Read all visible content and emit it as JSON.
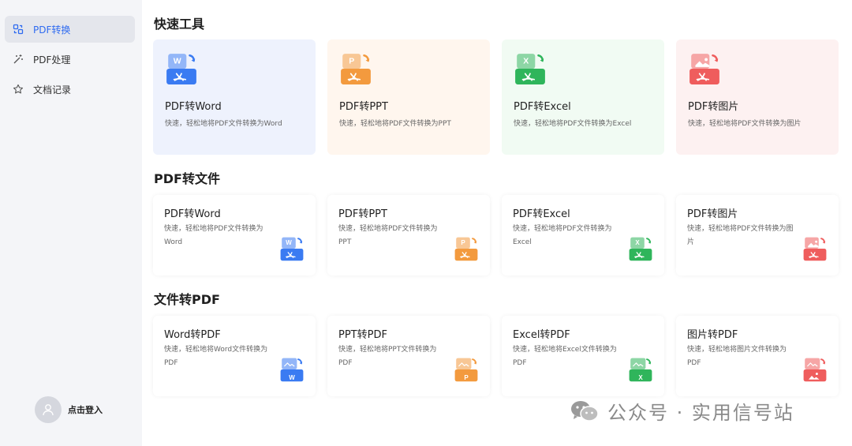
{
  "sidebar": {
    "items": [
      {
        "label": "PDF转换",
        "icon": "grid-swap-icon",
        "active": true
      },
      {
        "label": "PDF处理",
        "icon": "magic-wand-icon",
        "active": false
      },
      {
        "label": "文档记录",
        "icon": "star-icon",
        "active": false
      }
    ],
    "login_label": "点击登入"
  },
  "sections": {
    "quick": {
      "title": "快速工具",
      "cards": [
        {
          "title": "PDF转Word",
          "desc": "快速，轻松地将PDF文件转换为Word",
          "color": "#3a7bf2",
          "letter": "W",
          "bg": "#eef2fd"
        },
        {
          "title": "PDF转PPT",
          "desc": "快速，轻松地将PDF文件转换为PPT",
          "color": "#f39a3e",
          "letter": "P",
          "bg": "#fff6ee"
        },
        {
          "title": "PDF转Excel",
          "desc": "快速，轻松地将PDF文件转换为Excel",
          "color": "#2fb55b",
          "letter": "X",
          "bg": "#f1fbf3"
        },
        {
          "title": "PDF转图片",
          "desc": "快速，轻松地将PDF文件转换为图片",
          "color": "#ef5d5d",
          "letter": "img",
          "bg": "#fdf1f1"
        }
      ]
    },
    "pdf_to": {
      "title": "PDF转文件",
      "cards": [
        {
          "title": "PDF转Word",
          "desc": "快速，轻松地将PDF文件转换为Word",
          "color": "#3a7bf2",
          "letter": "W"
        },
        {
          "title": "PDF转PPT",
          "desc": "快速，轻松地将PDF文件转换为PPT",
          "color": "#f39a3e",
          "letter": "P"
        },
        {
          "title": "PDF转Excel",
          "desc": "快速，轻松地将PDF文件转换为Excel",
          "color": "#2fb55b",
          "letter": "X"
        },
        {
          "title": "PDF转图片",
          "desc": "快速，轻松地将PDF文件转换为图片",
          "color": "#ef5d5d",
          "letter": "img"
        }
      ]
    },
    "to_pdf": {
      "title": "文件转PDF",
      "cards": [
        {
          "title": "Word转PDF",
          "desc": "快速，轻松地将Word文件转换为PDF",
          "color": "#3a7bf2",
          "letter": "W"
        },
        {
          "title": "PPT转PDF",
          "desc": "快速，轻松地将PPT文件转换为PDF",
          "color": "#f39a3e",
          "letter": "P"
        },
        {
          "title": "Excel转PDF",
          "desc": "快速，轻松地将Excel文件转换为PDF",
          "color": "#2fb55b",
          "letter": "X"
        },
        {
          "title": "图片转PDF",
          "desc": "快速，轻松地将图片文件转换为PDF",
          "color": "#ef5d5d",
          "letter": "img"
        }
      ]
    }
  },
  "watermark": {
    "text": "公众号 · 实用信号站",
    "icon": "wechat-icon"
  }
}
